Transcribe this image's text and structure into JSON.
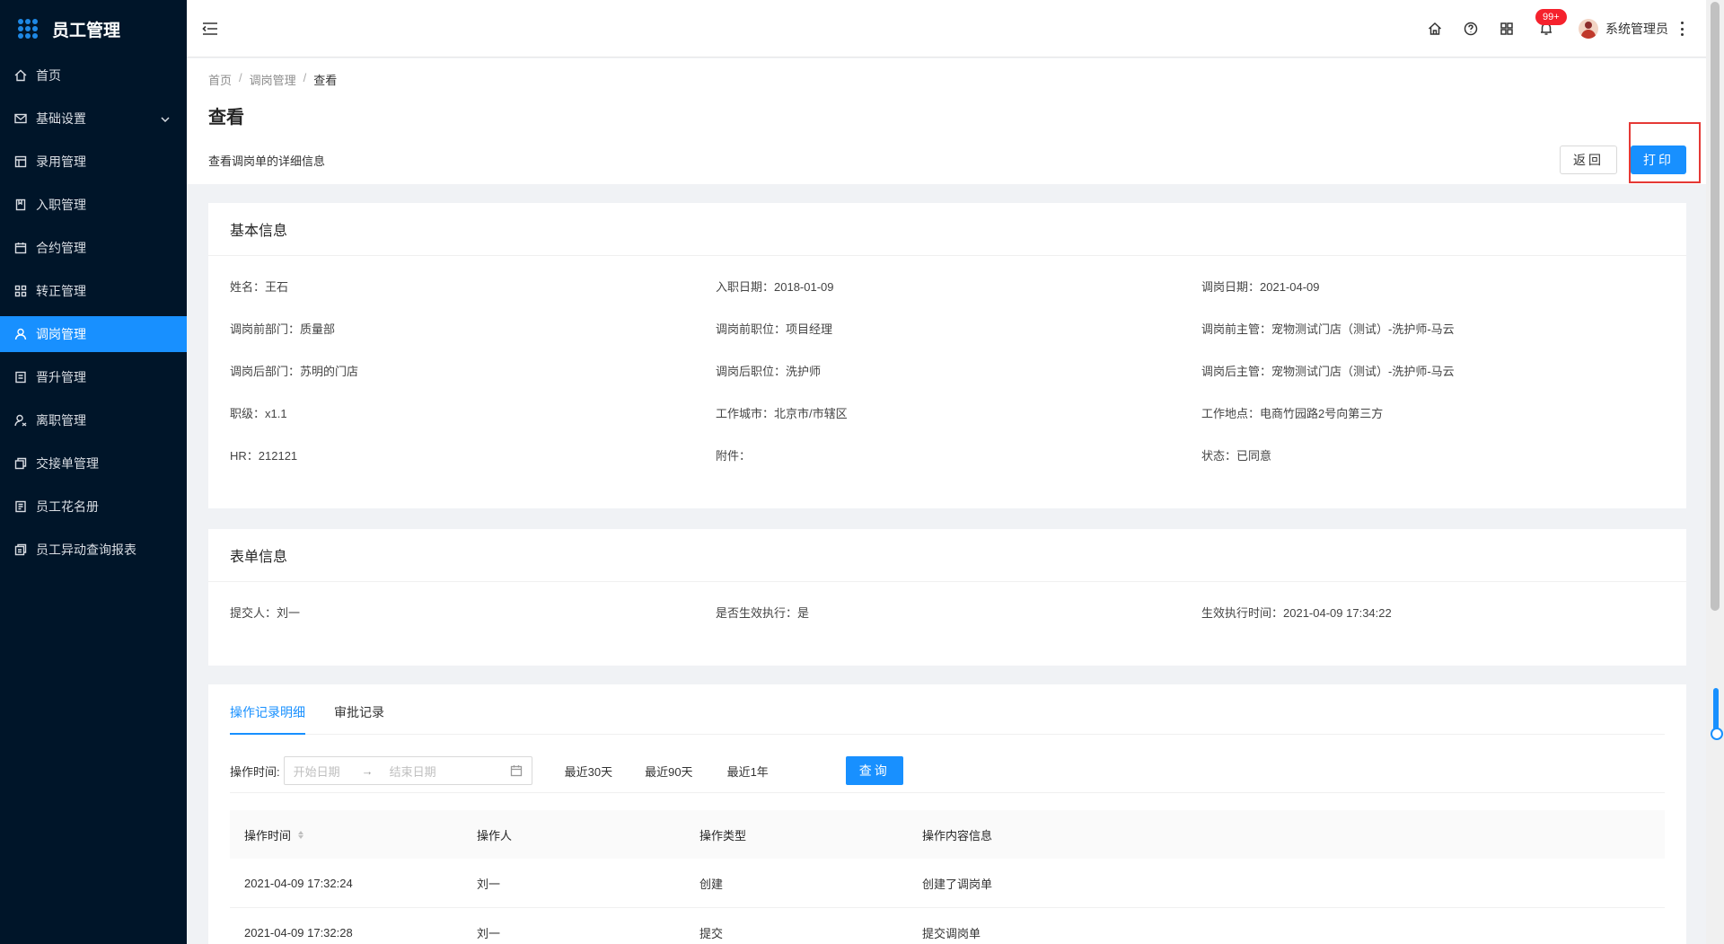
{
  "app": {
    "title": "员工管理"
  },
  "sidebar": {
    "items": [
      {
        "label": "首页",
        "icon": "home-icon"
      },
      {
        "label": "基础设置",
        "icon": "mail-icon",
        "has_children": true
      },
      {
        "label": "录用管理",
        "icon": "layout-icon"
      },
      {
        "label": "入职管理",
        "icon": "book-icon"
      },
      {
        "label": "合约管理",
        "icon": "calendar-icon"
      },
      {
        "label": "转正管理",
        "icon": "apps-icon"
      },
      {
        "label": "调岗管理",
        "icon": "user-icon",
        "active": true
      },
      {
        "label": "晋升管理",
        "icon": "file-icon"
      },
      {
        "label": "离职管理",
        "icon": "user-leave-icon"
      },
      {
        "label": "交接单管理",
        "icon": "copy-icon"
      },
      {
        "label": "员工花名册",
        "icon": "roster-icon"
      },
      {
        "label": "员工异动查询报表",
        "icon": "report-icon"
      }
    ]
  },
  "header": {
    "notification_count": "99+",
    "username": "系统管理员"
  },
  "page": {
    "breadcrumb": [
      "首页",
      "调岗管理",
      "查看"
    ],
    "title": "查看",
    "description": "查看调岗单的详细信息",
    "back_label": "返回",
    "print_label": "打印"
  },
  "basic_info": {
    "title": "基本信息",
    "fields": [
      {
        "label": "姓名：",
        "value": "王石"
      },
      {
        "label": "入职日期：",
        "value": "2018-01-09"
      },
      {
        "label": "调岗日期：",
        "value": "2021-04-09"
      },
      {
        "label": "调岗前部门：",
        "value": "质量部"
      },
      {
        "label": "调岗前职位：",
        "value": "项目经理"
      },
      {
        "label": "调岗前主管：",
        "value": "宠物测试门店（测试）-洗护师-马云"
      },
      {
        "label": "调岗后部门：",
        "value": "苏明的门店"
      },
      {
        "label": "调岗后职位：",
        "value": "洗护师"
      },
      {
        "label": "调岗后主管：",
        "value": "宠物测试门店（测试）-洗护师-马云"
      },
      {
        "label": "职级：",
        "value": "x1.1"
      },
      {
        "label": "工作城市：",
        "value": "北京市/市辖区"
      },
      {
        "label": "工作地点：",
        "value": "电商竹园路2号向第三方"
      },
      {
        "label": "HR：",
        "value": "212121"
      },
      {
        "label": "附件：",
        "value": ""
      },
      {
        "label": "状态：",
        "value": "已同意"
      }
    ]
  },
  "form_info": {
    "title": "表单信息",
    "fields": [
      {
        "label": "提交人：",
        "value": "刘一"
      },
      {
        "label": "是否生效执行：",
        "value": "是"
      },
      {
        "label": "生效执行时间：",
        "value": "2021-04-09 17:34:22"
      }
    ]
  },
  "records": {
    "tabs": [
      "操作记录明细",
      "审批记录"
    ],
    "filter": {
      "label": "操作时间:",
      "start_placeholder": "开始日期",
      "end_placeholder": "结束日期",
      "quick": [
        "最近30天",
        "最近90天",
        "最近1年"
      ],
      "query_label": "查询"
    },
    "columns": [
      "操作时间",
      "操作人",
      "操作类型",
      "操作内容信息"
    ],
    "rows": [
      {
        "time": "2021-04-09 17:32:24",
        "operator": "刘一",
        "type": "创建",
        "content": "创建了调岗单"
      },
      {
        "time": "2021-04-09 17:32:28",
        "operator": "刘一",
        "type": "提交",
        "content": "提交调岗单"
      }
    ]
  },
  "colors": {
    "primary": "#1890ff",
    "sidebar_bg": "#001529",
    "highlight": "#e53935"
  }
}
